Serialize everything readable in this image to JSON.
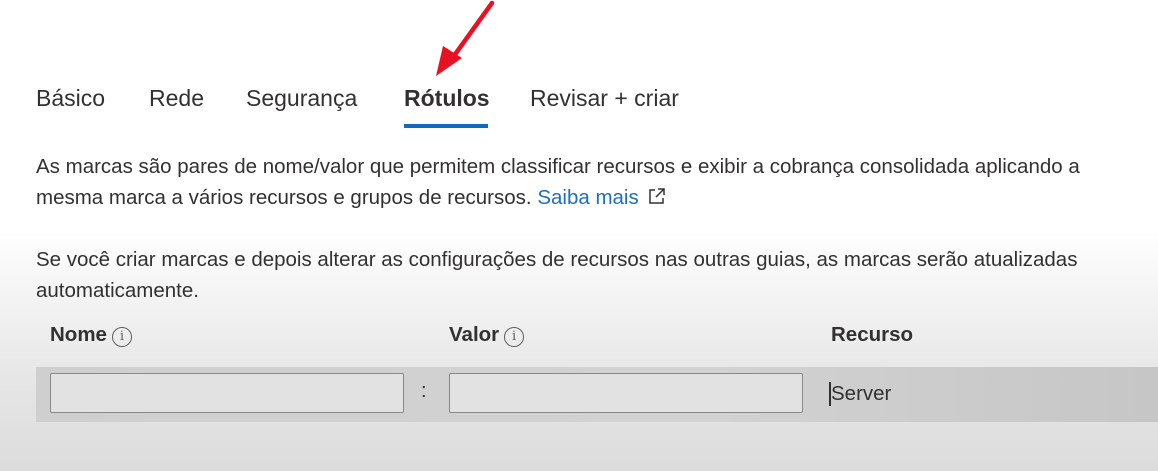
{
  "tabs": [
    {
      "label": "Básico"
    },
    {
      "label": "Rede"
    },
    {
      "label": "Segurança"
    },
    {
      "label": "Rótulos",
      "active": true
    },
    {
      "label": "Revisar + criar"
    }
  ],
  "description": {
    "line1": "As marcas são pares de nome/valor que permitem classificar recursos e exibir a cobrança consolidada aplicando a",
    "line2_text": "mesma marca a vários recursos e grupos de recursos.",
    "learn_more": "Saiba mais",
    "line3": "Se você criar marcas e depois alterar as configurações de recursos nas outras guias, as marcas serão atualizadas",
    "line4": "automaticamente."
  },
  "table": {
    "headers": {
      "name": "Nome",
      "value": "Valor",
      "resource": "Recurso"
    },
    "rows": [
      {
        "name": "",
        "value": "",
        "separator": ":",
        "resource": "Server"
      }
    ]
  },
  "icons": {
    "info": "info-icon",
    "external_link": "external-link-icon",
    "annotation": "red-arrow-annotation"
  },
  "colors": {
    "accent": "#0f6cbd",
    "link": "#1b6fbf",
    "annotation": "#e81123"
  }
}
